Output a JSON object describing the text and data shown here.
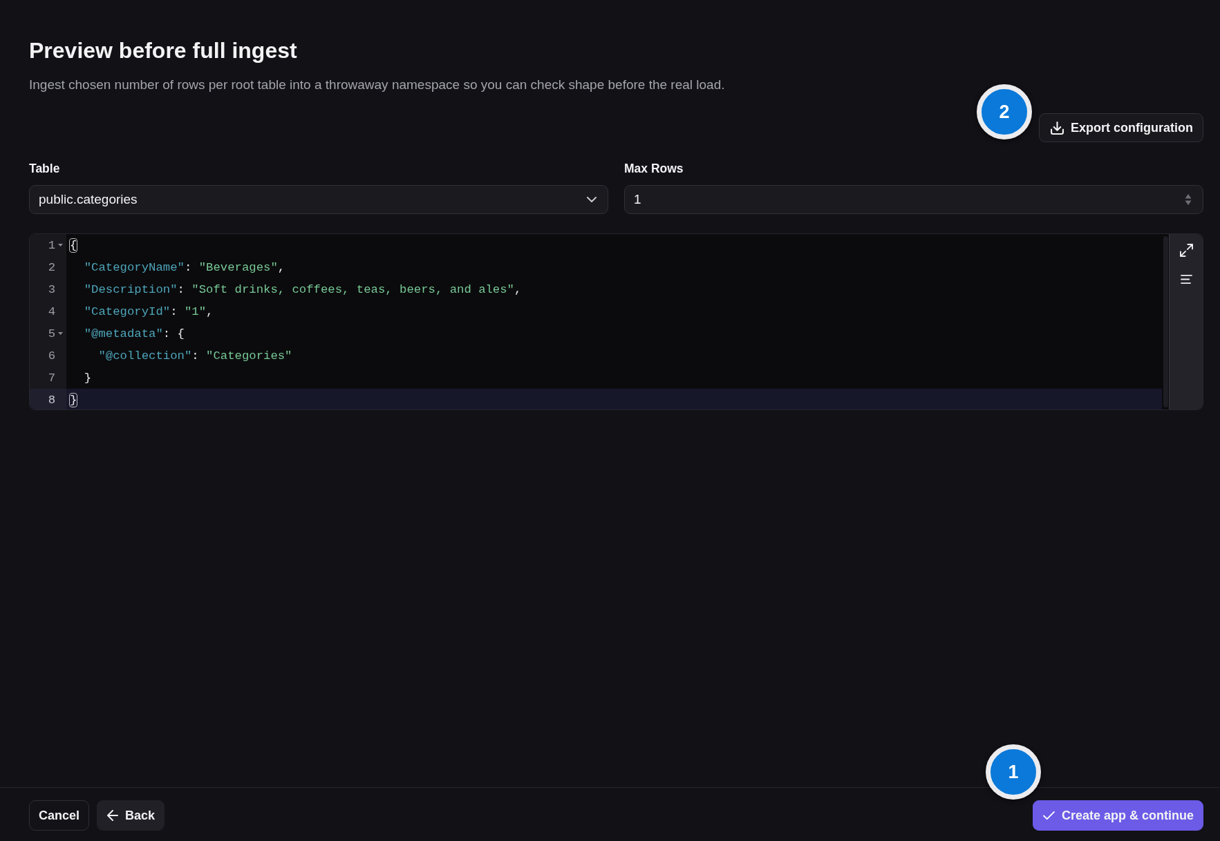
{
  "header": {
    "title": "Preview before full ingest",
    "description": "Ingest chosen number of rows per root table into a throwaway namespace so you can check shape before the real load.",
    "actions": [
      {
        "kind": "export",
        "label": "Export configuration",
        "callout": "2"
      }
    ]
  },
  "fields": [
    {
      "kind": "select",
      "label": "Table",
      "value": "public.categories"
    },
    {
      "kind": "number",
      "label": "Max Rows",
      "value": "1"
    }
  ],
  "editor": {
    "lines": [
      {
        "number": "1",
        "foldable": true,
        "active": false,
        "tokens": [
          {
            "kind": "bracket",
            "text": "{"
          }
        ],
        "children": [
          {
            "number": "2",
            "foldable": false,
            "active": false,
            "tokens": [
              {
                "kind": "key",
                "text": "\"CategoryName\""
              },
              {
                "kind": "punct",
                "text": ": "
              },
              {
                "kind": "string",
                "text": "\"Beverages\""
              },
              {
                "kind": "punct",
                "text": ","
              }
            ]
          },
          {
            "number": "3",
            "foldable": false,
            "active": false,
            "tokens": [
              {
                "kind": "key",
                "text": "\"Description\""
              },
              {
                "kind": "punct",
                "text": ": "
              },
              {
                "kind": "string",
                "text": "\"Soft drinks, coffees, teas, beers, and ales\""
              },
              {
                "kind": "punct",
                "text": ","
              }
            ]
          },
          {
            "number": "4",
            "foldable": false,
            "active": false,
            "tokens": [
              {
                "kind": "key",
                "text": "\"CategoryId\""
              },
              {
                "kind": "punct",
                "text": ": "
              },
              {
                "kind": "string",
                "text": "\"1\""
              },
              {
                "kind": "punct",
                "text": ","
              }
            ]
          },
          {
            "number": "5",
            "foldable": true,
            "active": false,
            "tokens": [
              {
                "kind": "key",
                "text": "\"@metadata\""
              },
              {
                "kind": "punct",
                "text": ": {"
              }
            ],
            "children": [
              {
                "number": "6",
                "foldable": false,
                "active": false,
                "tokens": [
                  {
                    "kind": "key",
                    "text": "\"@collection\""
                  },
                  {
                    "kind": "punct",
                    "text": ": "
                  },
                  {
                    "kind": "string",
                    "text": "\"Categories\""
                  }
                ]
              }
            ]
          },
          {
            "number": "7",
            "foldable": false,
            "active": false,
            "tokens": [
              {
                "kind": "punct",
                "text": "}"
              }
            ]
          }
        ]
      },
      {
        "number": "8",
        "foldable": false,
        "active": true,
        "tokens": [
          {
            "kind": "bracket",
            "text": "}"
          }
        ]
      }
    ]
  },
  "footer": {
    "buttons": [
      {
        "kind": "cancel",
        "label": "Cancel"
      },
      {
        "kind": "back",
        "label": "Back"
      },
      {
        "kind": "submit",
        "label": "Create app & continue",
        "callout": "1"
      }
    ]
  }
}
